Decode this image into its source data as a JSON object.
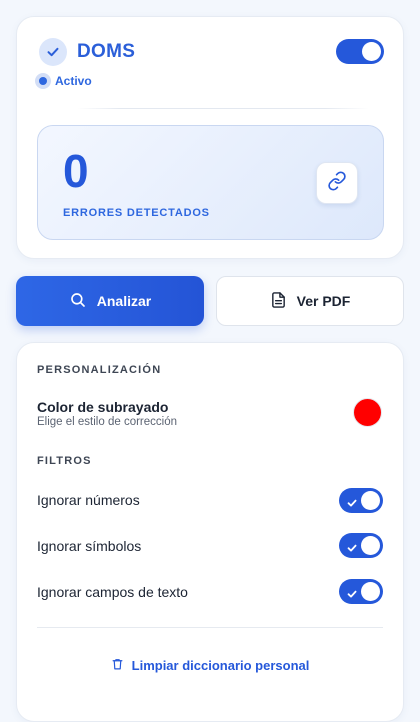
{
  "header": {
    "title": "DOMS",
    "status": "Activo",
    "enabled": true
  },
  "errors": {
    "count": "0",
    "label": "ERRORES DETECTADOS"
  },
  "actions": {
    "analyze_label": "Analizar",
    "pdf_label": "Ver PDF"
  },
  "settings": {
    "personalization_title": "PERSONALIZACIÓN",
    "underline_color": {
      "title": "Color de subrayado",
      "subtitle": "Elige el estilo de corrección",
      "value": "#ff0000"
    },
    "filters_title": "FILTROS",
    "filters": [
      {
        "label": "Ignorar números",
        "enabled": true
      },
      {
        "label": "Ignorar símbolos",
        "enabled": true
      },
      {
        "label": "Ignorar campos de texto",
        "enabled": true
      }
    ],
    "clear_label": "Limpiar diccionario personal"
  },
  "colors": {
    "accent": "#2558da",
    "underline": "#ff0000"
  },
  "icons": [
    "check-icon",
    "link-icon",
    "search-icon",
    "document-icon",
    "trash-icon"
  ]
}
